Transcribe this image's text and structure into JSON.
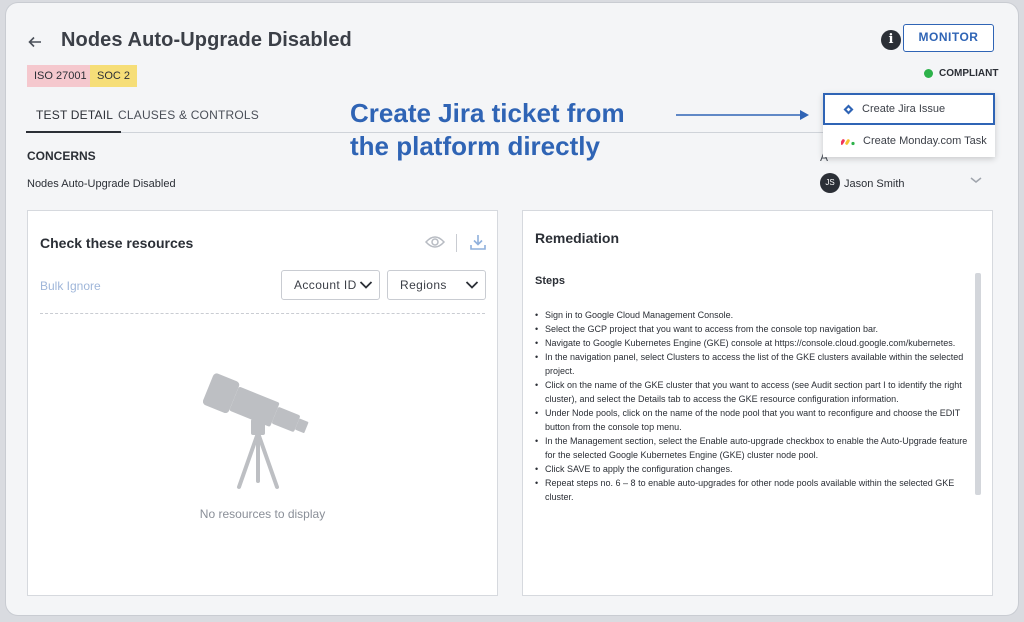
{
  "header": {
    "back_icon": "arrow-left-icon",
    "title": "Nodes Auto-Upgrade Disabled",
    "badges": [
      "ISO 27001",
      "SOC 2"
    ],
    "monitor_label": "MONITOR",
    "status": "COMPLIANT",
    "status_color": "#2db24a"
  },
  "tabs": [
    "TEST DETAIL",
    "CLAUSES & CONTROLS"
  ],
  "concerns": {
    "heading": "CONCERNS",
    "value": "Nodes Auto-Upgrade Disabled"
  },
  "callout": {
    "line1": "Create Jira ticket from",
    "line2": "the platform directly",
    "color": "#2f64b5"
  },
  "ticket_menu": {
    "items": [
      "Create Jira Issue",
      "Create Monday.com Task"
    ]
  },
  "assignee": {
    "partial_label": "A",
    "initials": "JS",
    "name": "Jason Smith"
  },
  "resources": {
    "title": "Check these resources",
    "bulk_ignore": "Bulk Ignore",
    "filters": [
      "Account ID",
      "Regions"
    ],
    "empty_text": "No resources to display"
  },
  "remediation": {
    "title": "Remediation",
    "steps_heading": "Steps",
    "steps": [
      "Sign in to Google Cloud Management Console.",
      "Select the GCP project that you want to access from the console top navigation bar.",
      "Navigate to Google Kubernetes Engine (GKE) console at https://console.cloud.google.com/kubernetes.",
      "In the navigation panel, select Clusters to access the list of the GKE clusters available within the selected project.",
      "Click on the name of the GKE cluster that you want to access (see Audit section part I to identify the right cluster), and select the Details tab to access the GKE resource configuration information.",
      "Under Node pools, click on the name of the node pool that you want to reconfigure and choose the EDIT button from the console top menu.",
      "In the Management section, select the Enable auto-upgrade checkbox to enable the Auto-Upgrade feature for the selected Google Kubernetes Engine (GKE) cluster node pool.",
      "Click SAVE to apply the configuration changes.",
      "Repeat steps no. 6 – 8 to enable auto-upgrades for other node pools available within the selected GKE cluster."
    ]
  }
}
